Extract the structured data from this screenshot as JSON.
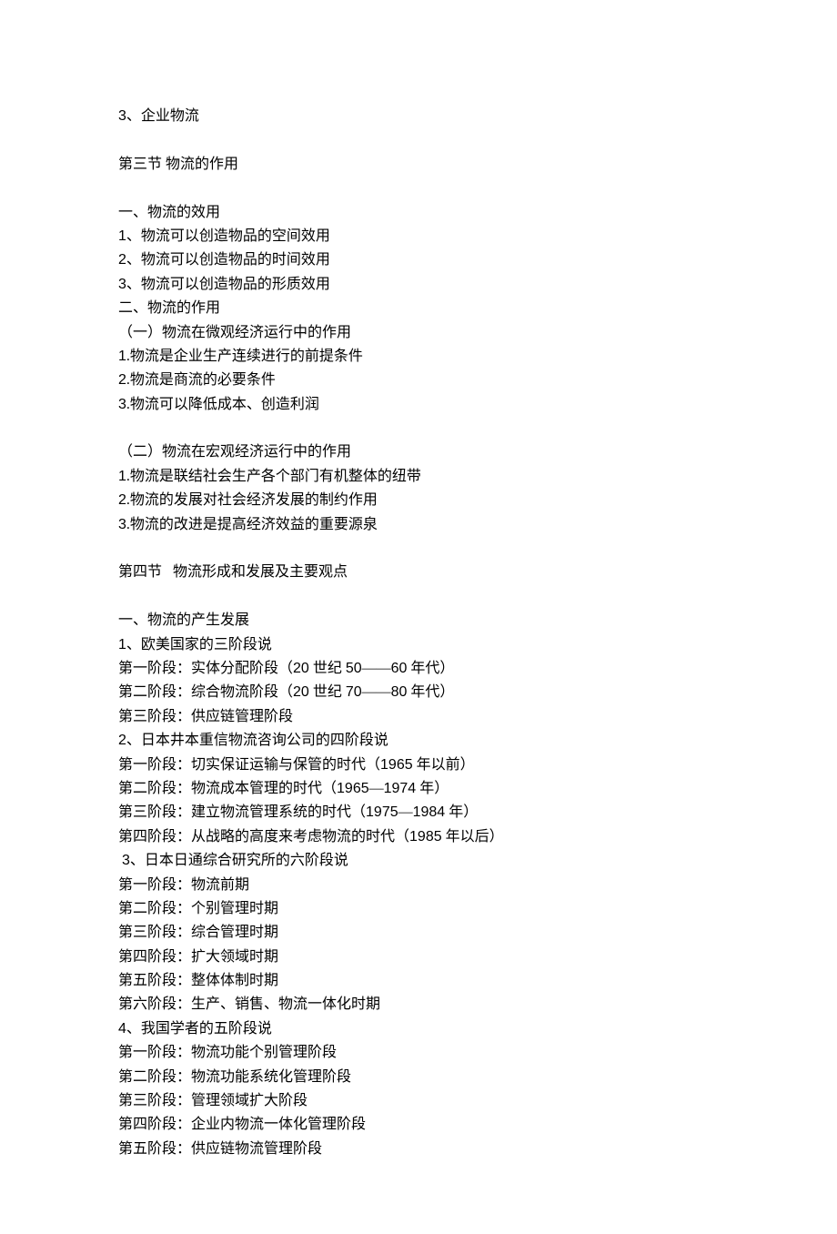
{
  "lines": [
    "3、企业物流",
    "",
    "第三节 物流的作用",
    "",
    "一、物流的效用",
    "1、物流可以创造物品的空间效用",
    "2、物流可以创造物品的时间效用",
    "3、物流可以创造物品的形质效用",
    "二、物流的作用",
    "（一）物流在微观经济运行中的作用",
    "1.物流是企业生产连续进行的前提条件",
    "2.物流是商流的必要条件",
    "3.物流可以降低成本、创造利润",
    "",
    "（二）物流在宏观经济运行中的作用",
    "1.物流是联结社会生产各个部门有机整体的纽带",
    "2.物流的发展对社会经济发展的制约作用",
    "3.物流的改进是提高经济效益的重要源泉",
    "",
    "第四节   物流形成和发展及主要观点",
    "",
    "一、物流的产生发展",
    "1、欧美国家的三阶段说",
    "第一阶段：实体分配阶段（20 世纪 50——60 年代）",
    "第二阶段：综合物流阶段（20 世纪 70——80 年代）",
    "第三阶段：供应链管理阶段",
    "2、日本井本重信物流咨询公司的四阶段说",
    "第一阶段：切实保证运输与保管的时代（1965 年以前）",
    "第二阶段：物流成本管理的时代（1965—1974 年）",
    "第三阶段：建立物流管理系统的时代（1975—1984 年）",
    "第四阶段：从战略的高度来考虑物流的时代（1985 年以后）",
    " 3、日本日通综合研究所的六阶段说",
    "第一阶段：物流前期",
    "第二阶段：个别管理时期",
    "第三阶段：综合管理时期",
    "第四阶段：扩大领域时期",
    "第五阶段：整体体制时期",
    "第六阶段：生产、销售、物流一体化时期",
    "4、我国学者的五阶段说",
    "第一阶段：物流功能个别管理阶段",
    "第二阶段：物流功能系统化管理阶段",
    "第三阶段：管理领域扩大阶段",
    "第四阶段：企业内物流一体化管理阶段",
    "第五阶段：供应链物流管理阶段"
  ]
}
